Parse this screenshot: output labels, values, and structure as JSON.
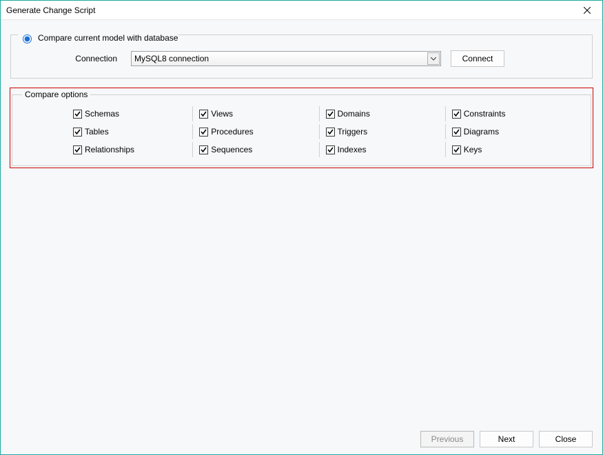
{
  "window": {
    "title": "Generate Change Script"
  },
  "compare": {
    "radio_label": "Compare current model with database",
    "radio_selected": true,
    "connection_label": "Connection",
    "connection_value": "MySQL8 connection",
    "connect_button": "Connect"
  },
  "options": {
    "legend": "Compare options",
    "items": [
      {
        "label": "Schemas",
        "checked": true
      },
      {
        "label": "Views",
        "checked": true
      },
      {
        "label": "Domains",
        "checked": true
      },
      {
        "label": "Constraints",
        "checked": true
      },
      {
        "label": "Tables",
        "checked": true
      },
      {
        "label": "Procedures",
        "checked": true
      },
      {
        "label": "Triggers",
        "checked": true
      },
      {
        "label": "Diagrams",
        "checked": true
      },
      {
        "label": "Relationships",
        "checked": true
      },
      {
        "label": "Sequences",
        "checked": true
      },
      {
        "label": "Indexes",
        "checked": true
      },
      {
        "label": "Keys",
        "checked": true
      }
    ]
  },
  "footer": {
    "previous": "Previous",
    "next": "Next",
    "close": "Close"
  }
}
